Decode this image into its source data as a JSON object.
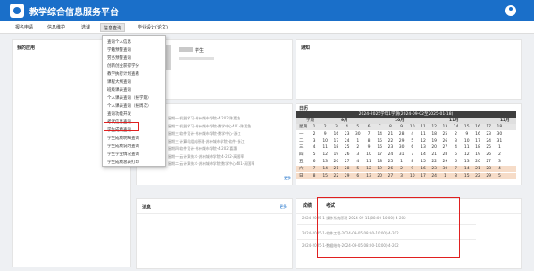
{
  "header": {
    "title": "教学综合信息服务平台",
    "avatar_icon": "user-avatar-icon"
  },
  "nav": {
    "items": [
      "报名申请",
      "信息维护",
      "选课",
      "信息查询",
      "毕业设计(论文)"
    ],
    "active": "信息查询"
  },
  "dropdown": {
    "items": [
      "查询个人信息",
      "学籍预警查询",
      "劳务预警查询",
      "创新创业获得学分",
      "教学执行计划查看",
      "课程大纲查询",
      "班级课表查询",
      "个人课表查询（按学期）",
      "个人课表查询（按周次）",
      "查询功能开发",
      "考试信息查询",
      "学生成绩查询",
      "学生成绩明细查询",
      "学生成绩说明查询",
      "学生学业情况查询",
      "学生成绩总表打印"
    ],
    "highlighted": "考试信息查询"
  },
  "panels": {
    "my_apps": "我的应用",
    "notice": "通知",
    "schedule": "日历",
    "messages": "消息",
    "more": "更多",
    "student_suffix": "学生"
  },
  "course_lines": [
    "星期一 机器学习-苏州城市学院-4-202-陈嘉鱼",
    "星期二 机器学习-苏州城市学院-数学中心401-陈嘉鱼",
    "星期三 软件设计-苏州城市学院-数学中心-浙江",
    "星期三 计算机组成原理-苏州城市学院-软件-浙江",
    "星期四 软件设计-苏州城市学院-4-202-喜惠",
    "星期一 云计算技术-苏州城市学院-4-202-高国率",
    "星期二 云计算技术-苏州城市学院-数学中心401-高国率"
  ],
  "calendar": {
    "range": "2024-2025学年1学期(2024-09-02至2025-01-18)",
    "week_label": "学期",
    "weekday_label": "星期",
    "months": [
      "9月",
      "10月",
      "11月",
      "12月"
    ],
    "weekdays": [
      "一",
      "二",
      "三",
      "四",
      "五",
      "六",
      "日"
    ],
    "rows": [
      [
        "1",
        "2",
        "3",
        "4",
        "5",
        "6",
        "7",
        "8",
        "9",
        "10",
        "11",
        "12",
        "13",
        "14",
        "15",
        "16",
        "17",
        "18"
      ],
      [
        "2",
        "9",
        "16",
        "23",
        "30",
        "7",
        "14",
        "21",
        "28",
        "4",
        "11",
        "18",
        "25",
        "2",
        "9",
        "16",
        "23",
        "30"
      ],
      [
        "3",
        "10",
        "17",
        "24",
        "1",
        "8",
        "15",
        "22",
        "29",
        "5",
        "12",
        "19",
        "26",
        "3",
        "10",
        "17",
        "24",
        "31"
      ],
      [
        "4",
        "11",
        "18",
        "25",
        "2",
        "9",
        "16",
        "23",
        "30",
        "6",
        "13",
        "20",
        "27",
        "4",
        "11",
        "18",
        "25",
        "1"
      ],
      [
        "5",
        "12",
        "19",
        "26",
        "3",
        "10",
        "17",
        "24",
        "31",
        "7",
        "14",
        "21",
        "28",
        "5",
        "12",
        "19",
        "26",
        "2"
      ],
      [
        "6",
        "13",
        "20",
        "27",
        "4",
        "11",
        "18",
        "25",
        "1",
        "8",
        "15",
        "22",
        "29",
        "6",
        "13",
        "20",
        "27",
        "3"
      ],
      [
        "7",
        "14",
        "21",
        "28",
        "5",
        "12",
        "19",
        "26",
        "2",
        "9",
        "16",
        "23",
        "30",
        "7",
        "14",
        "21",
        "28",
        "4"
      ],
      [
        "8",
        "15",
        "22",
        "29",
        "6",
        "13",
        "20",
        "27",
        "3",
        "10",
        "17",
        "24",
        "1",
        "8",
        "15",
        "22",
        "29",
        "5"
      ]
    ],
    "weekend_color": "#f6dcc8",
    "week_row_color": "#e6e6e6"
  },
  "tabs": {
    "grades": "成绩",
    "exams": "考试"
  },
  "exams": [
    "2024-2025-1-操作系统原理-2024-09-11(08:00-10:00)-4-202",
    "2024-2025-1-软件工程-2024-09-05(08:00-10:00)-4-202",
    "2024-2025-1-数据结构-2024-09-05(08:00-10:00)-4-202"
  ],
  "colors": {
    "brand": "#1a6fc9",
    "highlight": "#e02020"
  }
}
